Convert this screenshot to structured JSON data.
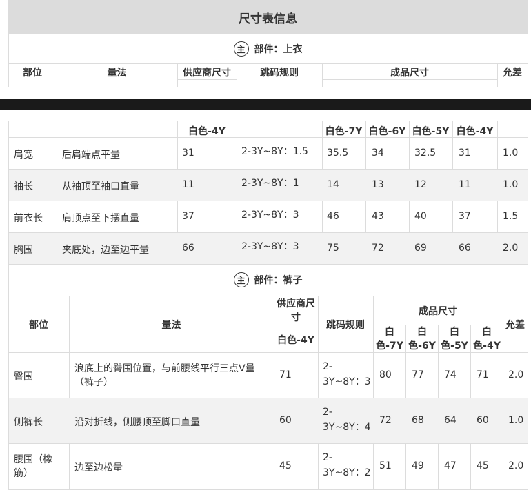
{
  "title": "尺寸表信息",
  "section_top": {
    "badge": "主",
    "label": "部件：上衣",
    "headers": {
      "part": "部位",
      "method": "量法",
      "supplier": "供应商尺寸",
      "rule": "跳码规则",
      "finished": "成品尺寸",
      "tolerance": "允差"
    },
    "supplier_size": "白色-4Y",
    "finished_sizes": [
      "白色-7Y",
      "白色-6Y",
      "白色-5Y",
      "白色-4Y"
    ],
    "rows": [
      {
        "part": "肩宽",
        "method": "后肩端点平量",
        "supplier": "31",
        "rule": "2-3Y~8Y：1.5",
        "sizes": [
          "35.5",
          "34",
          "32.5",
          "31"
        ],
        "tolerance": "1.0"
      },
      {
        "part": "袖长",
        "method": "从袖顶至袖口直量",
        "supplier": "11",
        "rule": "2-3Y~8Y：1",
        "sizes": [
          "14",
          "13",
          "12",
          "11"
        ],
        "tolerance": "1.0"
      },
      {
        "part": "前衣长",
        "method": "肩顶点至下摆直量",
        "supplier": "37",
        "rule": "2-3Y~8Y：3",
        "sizes": [
          "46",
          "43",
          "40",
          "37"
        ],
        "tolerance": "1.5"
      },
      {
        "part": "胸围",
        "method": "夹底处，边至边平量",
        "supplier": "66",
        "rule": "2-3Y~8Y：3",
        "sizes": [
          "75",
          "72",
          "69",
          "66"
        ],
        "tolerance": "2.0"
      }
    ]
  },
  "section_bottom": {
    "badge": "主",
    "label": "部件：裤子",
    "headers": {
      "part": "部位",
      "method": "量法",
      "supplier": "供应商尺寸",
      "rule": "跳码规则",
      "finished": "成品尺寸",
      "tolerance": "允差"
    },
    "supplier_size": "白色-4Y",
    "finished_sizes": [
      "白色-7Y",
      "白色-6Y",
      "白色-5Y",
      "白色-4Y"
    ],
    "rows": [
      {
        "part": "臀围",
        "method": "浪底上的臀围位置，与前腰线平行三点V量（裤子）",
        "supplier": "71",
        "rule": "2-3Y~8Y：3",
        "sizes": [
          "80",
          "77",
          "74",
          "71"
        ],
        "tolerance": "2.0"
      },
      {
        "part": "侧裤长",
        "method": "沿对折线，侧腰顶至脚口直量",
        "supplier": "60",
        "rule": "2-3Y~8Y：4",
        "sizes": [
          "72",
          "68",
          "64",
          "60"
        ],
        "tolerance": "1.0"
      },
      {
        "part": "腰围（橡筋）",
        "method": "边至边松量",
        "supplier": "45",
        "rule": "2-3Y~8Y：2",
        "sizes": [
          "51",
          "49",
          "47",
          "45"
        ],
        "tolerance": "2.0"
      }
    ]
  }
}
